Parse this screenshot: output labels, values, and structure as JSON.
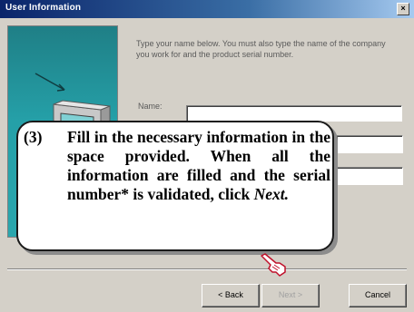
{
  "window": {
    "title": "User Information",
    "close_glyph": "×"
  },
  "illustration": {
    "icon": "computer-wizard-graphic"
  },
  "form": {
    "instructions": "Type your name below. You must also type the name of the company you work for and the product serial number.",
    "name_label": "Name:",
    "name_value": "",
    "company_value": "",
    "serial_value": ""
  },
  "buttons": {
    "back": "< Back",
    "next": "Next >",
    "cancel": "Cancel"
  },
  "callout": {
    "number": "(3)",
    "text_before": "Fill in the necessary information in the space provided. When all the information are filled and the serial number* is validated, click ",
    "emphasis": "Next.",
    "pointer_icon": "pointing-hand-icon"
  },
  "colors": {
    "title_bar": "#0a246a",
    "illustration": "#25a0a8",
    "dialog_bg": "#d4d0c8"
  }
}
